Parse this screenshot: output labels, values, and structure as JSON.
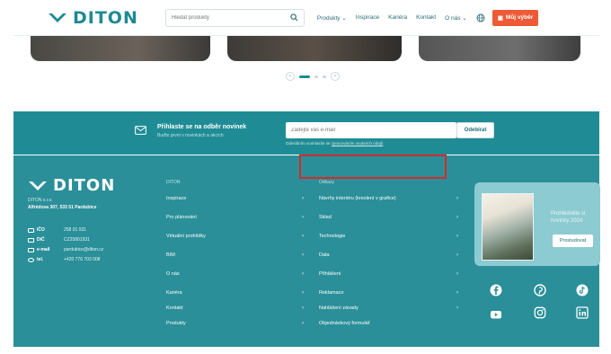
{
  "header": {
    "logo_text": "DITON",
    "search_placeholder": "Hledat produkty",
    "nav": [
      "Produkty ⌄",
      "Inspirace",
      "Kariéra",
      "Kontakt",
      "O nás ⌄"
    ],
    "cart_label": "Můj výběr"
  },
  "pager": {
    "prev": "‹",
    "next": "›"
  },
  "newsletter": {
    "title": "Přihlaste se na odběr novinek",
    "subtitle": "Buďte první v novinkách a akcích",
    "input_placeholder": "Zadejte váš e-mail",
    "button": "Odebírat",
    "note_prefix": "Odesláním souhlasíte se ",
    "note_link": "zpracováním osobních údajů"
  },
  "footer": {
    "logo_text": "DITON",
    "company": "DITON s.r.o.",
    "address": "Alfrédova 307, 533 51 Pardubice",
    "contacts": [
      {
        "label": "IČO",
        "value": "258 01 931"
      },
      {
        "label": "DIČ",
        "value": "CZ25801931"
      },
      {
        "label": "e-mail",
        "value": "pardubice@diton.cz"
      },
      {
        "label": "tel.",
        "value": "+420 776 703 008"
      }
    ],
    "col1_head": "DITON",
    "col1_links": [
      "Inspirace",
      "Pro plánování",
      "Virtuální prohlídky",
      "BIM",
      "O nás",
      "Kariéra",
      "Kontakt",
      "Produkty"
    ],
    "col2_head": "Odkazy",
    "col2_links": [
      "Návrhy interiéru (kreslení v grafice)",
      "Sklad",
      "Technologie",
      "Data",
      "Přihlášení",
      "Reklamace",
      "Nahlášení závady",
      "Objednávkový formulář"
    ],
    "promo_text": "Prohlédněte si novinky 2024",
    "promo_button": "Prostudovat",
    "social_icons": [
      "facebook-icon",
      "pinterest-icon",
      "tiktok-icon",
      "youtube-icon",
      "instagram-icon",
      "linkedin-icon"
    ]
  }
}
